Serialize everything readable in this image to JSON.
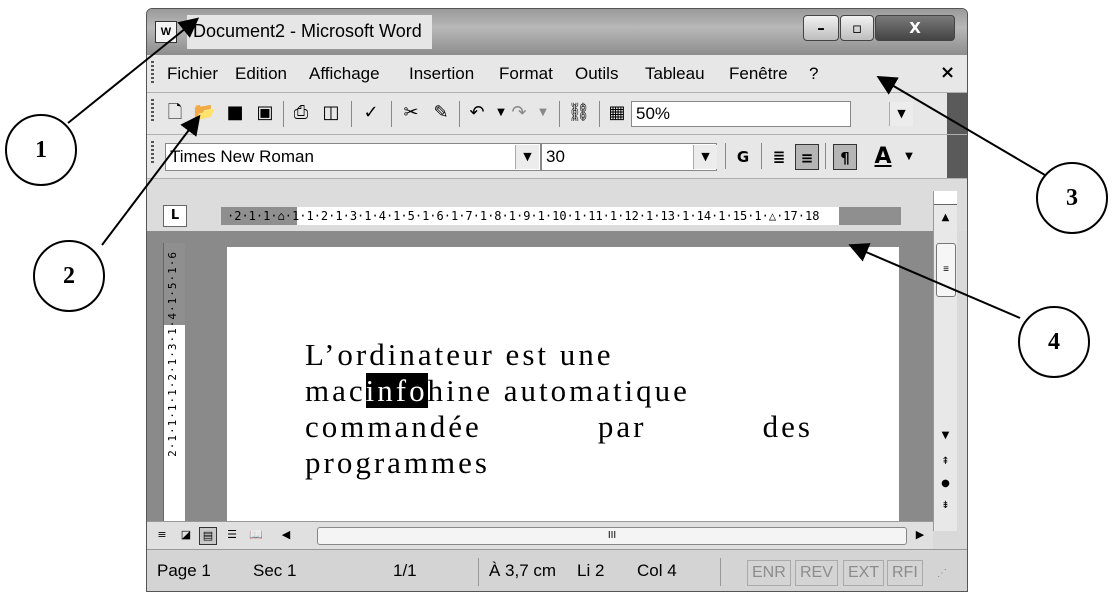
{
  "window": {
    "title": "Document2 - Microsoft Word",
    "app_icon": "W",
    "controls": {
      "minimize": "–",
      "maximize": "▫",
      "close": "X"
    }
  },
  "menu": {
    "items": [
      "Fichier",
      "Edition",
      "Affichage",
      "Insertion",
      "Format",
      "Outils",
      "Tableau",
      "Fenêtre",
      "?"
    ],
    "close": "×"
  },
  "standard_toolbar": {
    "icons": [
      "new-document-icon",
      "open-icon",
      "save-icon",
      "permission-icon",
      "print-icon",
      "print-preview-icon",
      "spelling-icon",
      "cut-icon",
      "format-painter-icon",
      "undo-icon",
      "redo-icon",
      "hyperlink-icon",
      "tables-borders-icon"
    ],
    "zoom": "50%"
  },
  "formatting_toolbar": {
    "font": "Times New Roman",
    "size": "30",
    "bold": "G",
    "font_color": "A"
  },
  "ruler": {
    "tab_selector": "L",
    "horizontal": "·2·1·1·⌂·1·1·2·1·3·1·4·1·5·1·6·1·7·1·8·1·9·1·10·1·11·1·12·1·13·1·14·1·15·1·△·17·18",
    "vertical": "2·1·1·1·1·2·1·3·1·4·1·5·1·6"
  },
  "document": {
    "lines": [
      {
        "text": "L’ordinateur est une"
      },
      {
        "before": "mac",
        "selected": "info",
        "after": "hine automatique"
      },
      {
        "words": [
          "commandée",
          "par",
          "des"
        ]
      },
      {
        "text": "programmes"
      }
    ]
  },
  "scrollbar": {
    "up": "▲",
    "down": "▼",
    "grip": "≡",
    "prev_page": "⇞",
    "select_browse": "●",
    "next_page": "⇟"
  },
  "hscroll": {
    "left": "◀",
    "right": "▶",
    "grip": "III"
  },
  "status": {
    "page": "Page 1",
    "section": "Sec 1",
    "pages": "1/1",
    "position": "À 3,7 cm",
    "line": "Li 2",
    "column": "Col 4",
    "flags": [
      "ENR",
      "REV",
      "EXT",
      "RFI"
    ]
  },
  "callouts": [
    "1",
    "2",
    "3",
    "4"
  ],
  "colors": {
    "selection": "#000000",
    "page": "#ffffff",
    "workspace": "#8a8a8a"
  }
}
